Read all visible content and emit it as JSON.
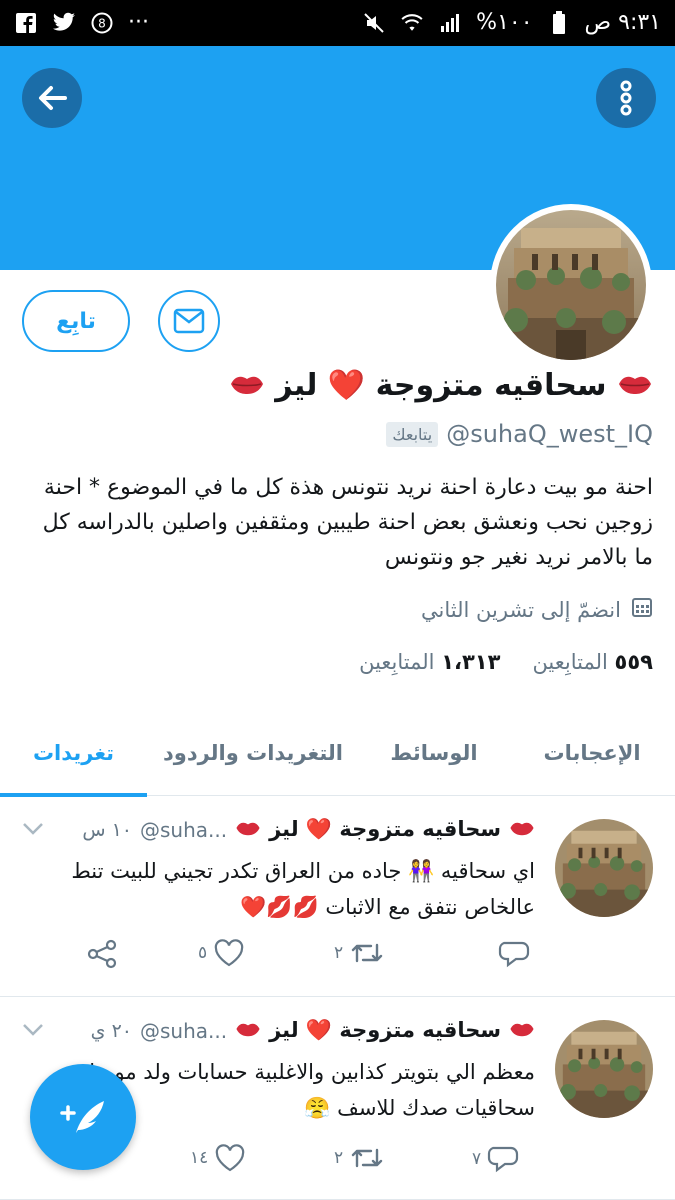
{
  "status_bar": {
    "time": "٩:٣١ ص",
    "battery": "%١٠٠",
    "more": "···"
  },
  "profile": {
    "name": "سحاقيه متزوجة ❤️ ليز",
    "handle": "@suhaQ_west_IQ",
    "follows_you": "يتابعك",
    "follow_button": "تابِع",
    "bio": "احنة مو بيت دعارة احنة نريد نتونس هذة كل ما في الموضوع * احنة زوجين نحب ونعشق بعض احنة طيبين ومثقفين واصلين بالدراسه كل ما بالامر نريد نغير جو ونتونس",
    "joined": "انضمّ إلى تشرين الثاني",
    "following_count": "٥٥٩",
    "following_label": "المتابِعين",
    "followers_count": "١،٣١٣",
    "followers_label": "المتابِعين"
  },
  "tabs": [
    {
      "label": "الإعجابات"
    },
    {
      "label": "الوسائط"
    },
    {
      "label": "التغريدات والردود"
    },
    {
      "label": "تغريدات"
    }
  ],
  "tweets": [
    {
      "name": "سحاقيه متزوجة ❤️ ليز",
      "handle": "@suha...",
      "time": "١٠ س",
      "text": "اي سحاقيه 👭 جاده من العراق تكدر تجيني للبيت تنط عالخاص نتفق مع الاثبات 💋💋❤️",
      "replies": "",
      "retweets": "٢",
      "likes": "٥"
    },
    {
      "name": "سحاقيه متزوجة ❤️ ليز",
      "handle": "@suha...",
      "time": "٢٠ ي",
      "text": "معظم الي بتويتر كذابين والاغلبية حسابات ولد مو بنات سحاقيات صدك للاسف 😤",
      "replies": "٧",
      "retweets": "٢",
      "likes": "١٤"
    }
  ],
  "colors": {
    "accent": "#1da1f2",
    "header_button": "#1b6da8",
    "muted": "#657786"
  }
}
